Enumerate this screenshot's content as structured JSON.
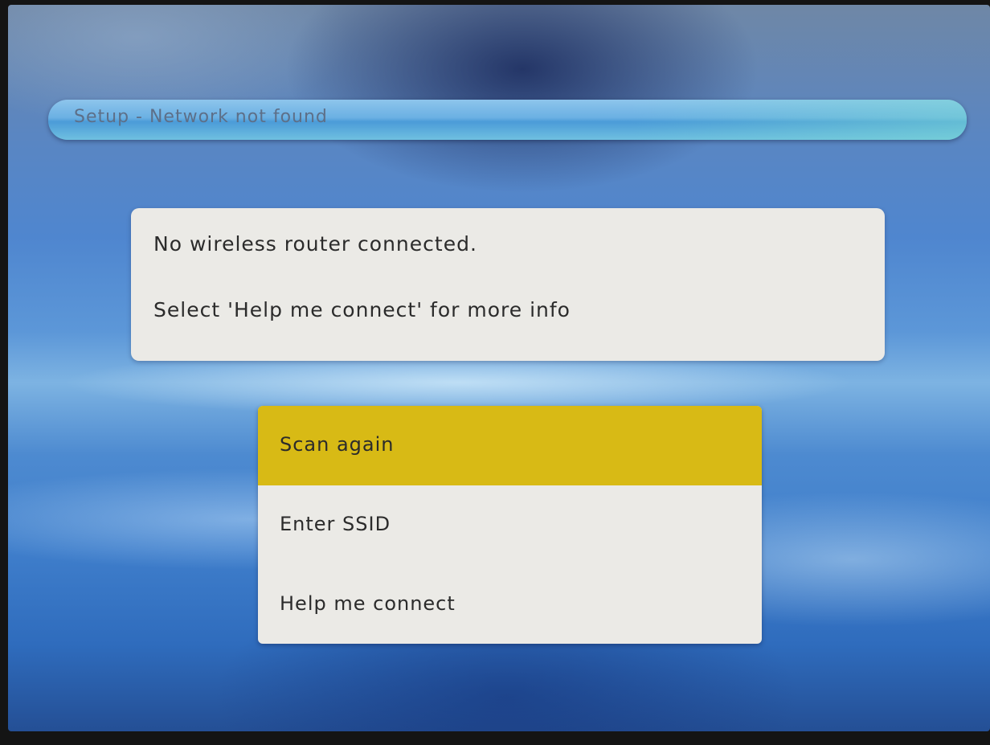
{
  "header": {
    "title": "Setup - Network not found"
  },
  "message": {
    "line1": "No wireless router connected.",
    "line2": "Select 'Help me connect' for more info"
  },
  "menu": {
    "selected_index": 0,
    "highlight_color": "#d8ba15",
    "items": [
      {
        "label": "Scan again"
      },
      {
        "label": "Enter SSID"
      },
      {
        "label": "Help me connect"
      }
    ]
  }
}
